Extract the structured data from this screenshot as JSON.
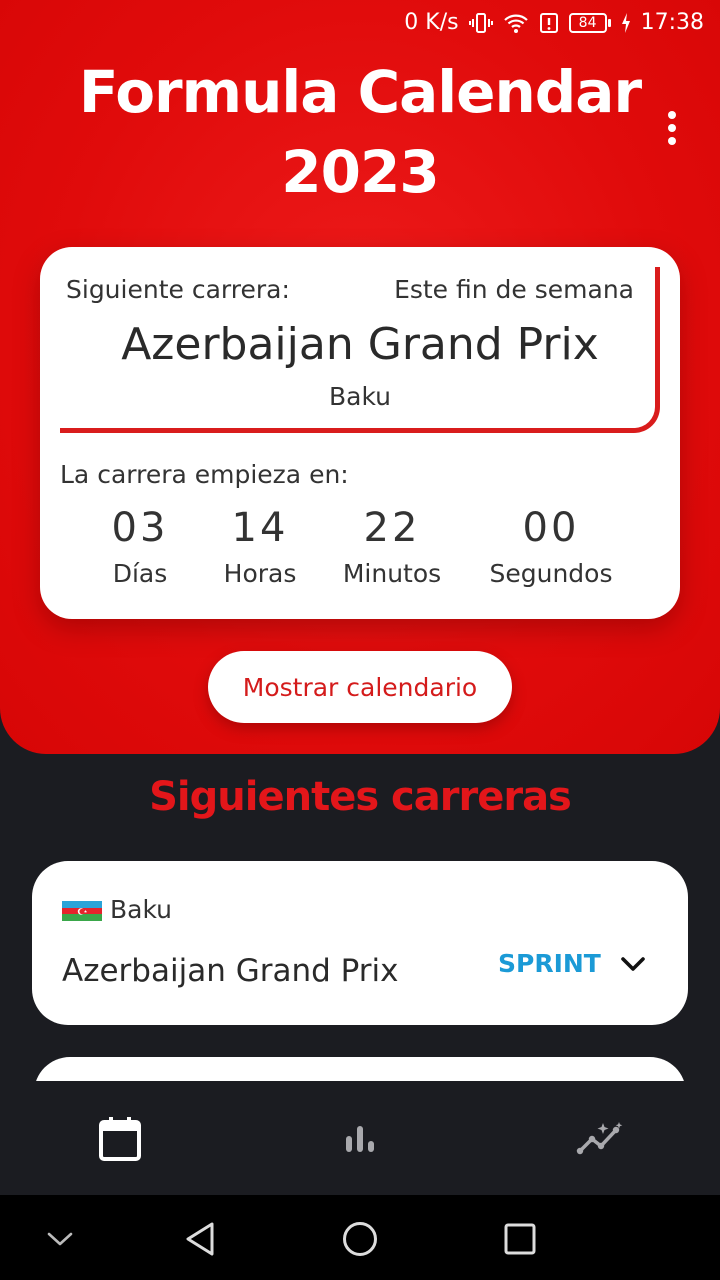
{
  "status_bar": {
    "net_speed": "0 K/s",
    "battery": "84",
    "time": "17:38",
    "icons": [
      "vibrate-icon",
      "wifi-icon",
      "alert-icon",
      "battery-icon",
      "charging-icon"
    ]
  },
  "header": {
    "title": "Formula Calendar 2023",
    "menu_icon": "more-vert-icon"
  },
  "next_race": {
    "label": "Siguiente carrera:",
    "when": "Este fin de semana",
    "name": "Azerbaijan Grand Prix",
    "city": "Baku",
    "starts_label": "La carrera empieza en:",
    "countdown": [
      {
        "value": "03",
        "label": "Días"
      },
      {
        "value": "14",
        "label": "Horas"
      },
      {
        "value": "22",
        "label": "Minutos"
      },
      {
        "value": "00",
        "label": "Segundos"
      }
    ]
  },
  "show_calendar_label": "Mostrar calendario",
  "upcoming": {
    "title": "Siguientes carreras",
    "races": [
      {
        "flag": "azerbaijan-flag-icon",
        "city": "Baku",
        "name": "Azerbaijan Grand Prix",
        "badge": "SPRINT"
      }
    ]
  },
  "bottom_nav": [
    {
      "icon": "calendar-icon",
      "active": true
    },
    {
      "icon": "bar-chart-icon",
      "active": false
    },
    {
      "icon": "insights-icon",
      "active": false
    }
  ],
  "colors": {
    "brand_red": "#e00b0b",
    "accent_red": "#d91c1c",
    "sprint_blue": "#1b9ad6",
    "background_dark": "#1b1c21"
  }
}
